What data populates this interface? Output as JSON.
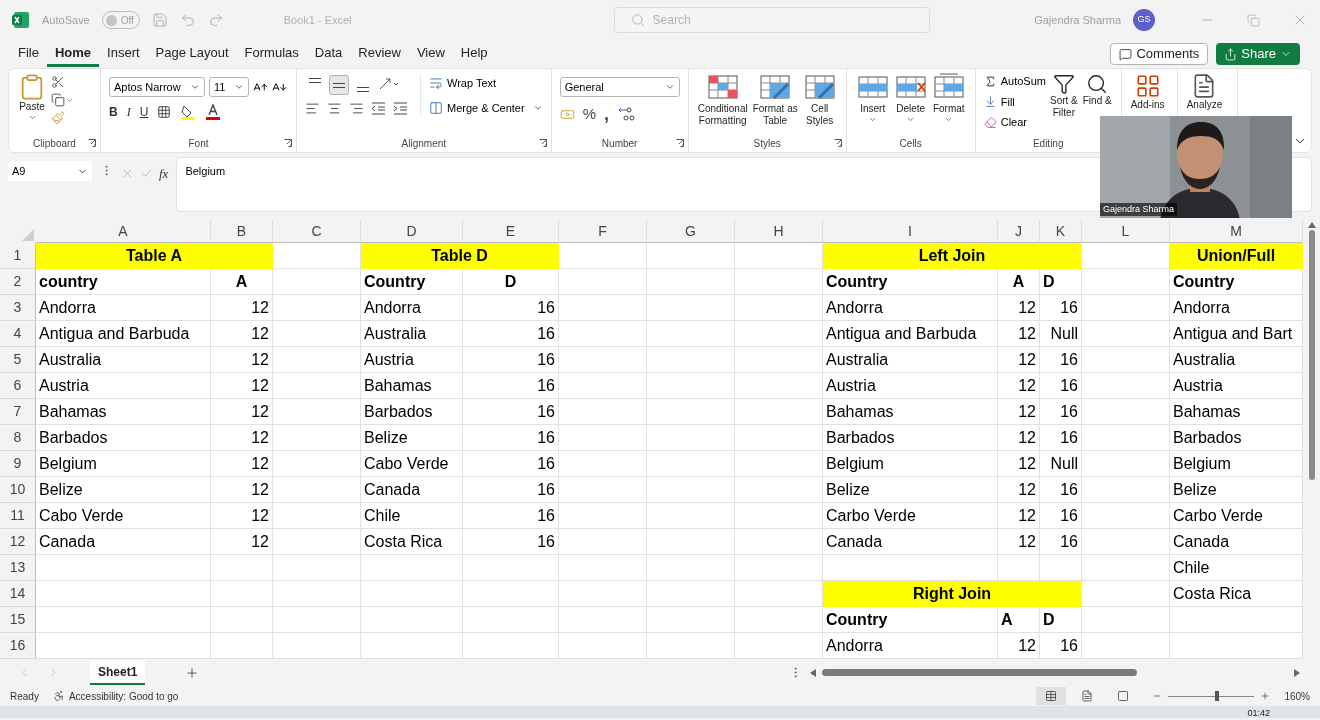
{
  "title_bar": {
    "autosave_label": "AutoSave",
    "autosave": {
      "on": false,
      "label": "Off"
    },
    "document_title": "Book1 - Excel",
    "search_placeholder": "Search",
    "user_name": "Gajendra Sharma",
    "avatar": "GS"
  },
  "menu_tabs": [
    {
      "label": "File",
      "selected": false
    },
    {
      "label": "Home",
      "selected": true
    },
    {
      "label": "Insert",
      "selected": false
    },
    {
      "label": "Page Layout",
      "selected": false
    },
    {
      "label": "Formulas",
      "selected": false
    },
    {
      "label": "Data",
      "selected": false
    },
    {
      "label": "Review",
      "selected": false
    },
    {
      "label": "View",
      "selected": false
    },
    {
      "label": "Help",
      "selected": false
    }
  ],
  "comments_button": "Comments",
  "share_button": "Share",
  "ribbon": {
    "clipboard": {
      "label": "Clipboard",
      "paste": "Paste"
    },
    "font": {
      "label": "Font",
      "font_name": "Aptos Narrow",
      "font_size": "11",
      "bold": "B",
      "italic": "I",
      "underline": "U"
    },
    "alignment": {
      "label": "Alignment",
      "vertical_align_buttons": [
        {
          "selected": false
        },
        {
          "selected": true
        },
        {
          "selected": false
        }
      ],
      "wrap_text": "Wrap Text",
      "merge_center": "Merge & Center"
    },
    "number": {
      "label": "Number",
      "format": "General",
      "percent": "%",
      "comma": ","
    },
    "styles": {
      "label": "Styles",
      "buttons": [
        {
          "lines": [
            "Conditional",
            "Formatting"
          ]
        },
        {
          "lines": [
            "Format as",
            "Table"
          ]
        },
        {
          "lines": [
            "Cell",
            "Styles"
          ]
        }
      ]
    },
    "cells": {
      "label": "Cells",
      "buttons": [
        "Insert",
        "Delete",
        "Format"
      ]
    },
    "editing": {
      "label": "Editing",
      "autosum": "AutoSum",
      "fill": "Fill",
      "clear": "Clear",
      "sort_filter": [
        "Sort &",
        "Filter"
      ],
      "find": "Find &"
    },
    "add_ins": "Add-ins",
    "analyze": "Analyze"
  },
  "formula_bar": {
    "cell_reference": "A9",
    "function_label": "fx",
    "content": "Belgium"
  },
  "grid": {
    "columns": [
      "A",
      "B",
      "C",
      "D",
      "E",
      "F",
      "G",
      "H",
      "I",
      "J",
      "K",
      "L",
      "M"
    ],
    "row_numbers": [
      "1",
      "2",
      "3",
      "4",
      "5",
      "6",
      "7",
      "8",
      "9",
      "10",
      "11",
      "12",
      "13",
      "14",
      "15",
      "16"
    ],
    "tables": [
      {
        "title": "Table A",
        "header": [
          "country",
          "A"
        ],
        "rows": [
          [
            "Andorra",
            "12"
          ],
          [
            "Antigua and Barbuda",
            "12"
          ],
          [
            "Australia",
            "12"
          ],
          [
            "Austria",
            "12"
          ],
          [
            "Bahamas",
            "12"
          ],
          [
            "Barbados",
            "12"
          ],
          [
            "Belgium",
            "12"
          ],
          [
            "Belize",
            "12"
          ],
          [
            "Cabo Verde",
            "12"
          ],
          [
            "Canada",
            "12"
          ]
        ]
      },
      {
        "title": "Table D",
        "header": [
          "Country",
          "D"
        ],
        "rows": [
          [
            "Andorra",
            "16"
          ],
          [
            "Australia",
            "16"
          ],
          [
            "Austria",
            "16"
          ],
          [
            "Bahamas",
            "16"
          ],
          [
            "Barbados",
            "16"
          ],
          [
            "Belize",
            "16"
          ],
          [
            "Cabo Verde",
            "16"
          ],
          [
            "Canada",
            "16"
          ],
          [
            "Chile",
            "16"
          ],
          [
            "Costa Rica",
            "16"
          ]
        ]
      },
      {
        "title": "Left Join",
        "header": [
          "Country",
          "A",
          "D"
        ],
        "rows": [
          [
            "Andorra",
            "12",
            "16"
          ],
          [
            "Antigua and Barbuda",
            "12",
            "Null"
          ],
          [
            "Australia",
            "12",
            "16"
          ],
          [
            "Austria",
            "12",
            "16"
          ],
          [
            "Bahamas",
            "12",
            "16"
          ],
          [
            "Barbados",
            "12",
            "16"
          ],
          [
            "Belgium",
            "12",
            "Null"
          ],
          [
            "Belize",
            "12",
            "16"
          ],
          [
            "Carbo Verde",
            "12",
            "16"
          ],
          [
            "Canada",
            "12",
            "16"
          ]
        ]
      },
      {
        "title": "Right Join",
        "header": [
          "Country",
          "A",
          "D"
        ],
        "rows": [
          [
            "Andorra",
            "12",
            "16"
          ]
        ]
      },
      {
        "title": "Union/Full",
        "header": [
          "Country"
        ],
        "rows": [
          [
            "Andorra"
          ],
          [
            "Antigua and Bart"
          ],
          [
            "Australia"
          ],
          [
            "Austria"
          ],
          [
            "Bahamas"
          ],
          [
            "Barbados"
          ],
          [
            "Belgium"
          ],
          [
            "Belize"
          ],
          [
            "Carbo Verde"
          ],
          [
            "Canada"
          ],
          [
            "Chile"
          ],
          [
            "Costa Rica"
          ]
        ]
      }
    ]
  },
  "sheet_tabs": [
    {
      "label": "Sheet1",
      "selected": true
    }
  ],
  "status_bar": {
    "ready": "Ready",
    "accessibility": "Accessibility: Good to go",
    "views": [
      {
        "selected": true
      },
      {
        "selected": false
      },
      {
        "selected": false
      }
    ],
    "zoom": {
      "level": 0.57,
      "label": "160%"
    }
  },
  "webcam": {
    "kind": "picture",
    "name": "Gajendra Sharma"
  },
  "taskbar": {
    "clock": "01:42"
  }
}
